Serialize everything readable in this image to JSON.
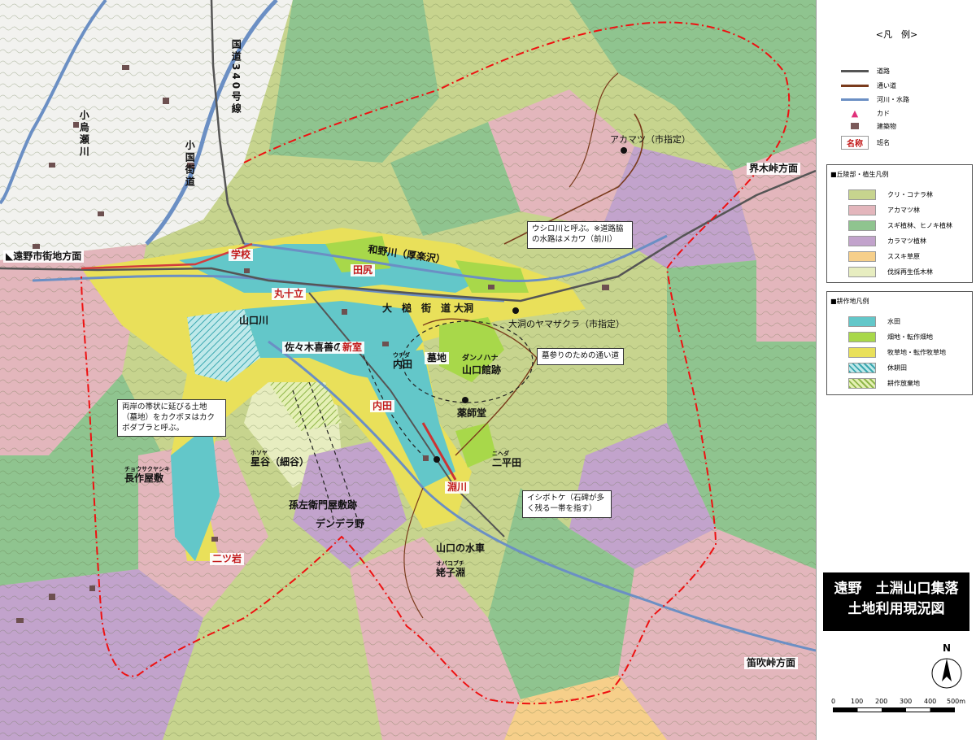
{
  "legend": {
    "title": "<凡　例>",
    "items": [
      {
        "label": "道路",
        "color": "#555555",
        "kind": "line"
      },
      {
        "label": "通い道",
        "color": "#7a3b1c",
        "kind": "line"
      },
      {
        "label": "河川・水路",
        "color": "#6b8fc4",
        "kind": "line"
      },
      {
        "label": "カド",
        "color": "#e0307a",
        "kind": "triangle"
      },
      {
        "label": "建築物",
        "color": "#7b5a5a",
        "kind": "square"
      },
      {
        "label": "班名",
        "color": "#c21a1a",
        "kind": "name",
        "sample": "名称"
      }
    ],
    "forest": {
      "heading": "■丘陵部・植生凡例",
      "items": [
        {
          "label": "クリ・コナラ林",
          "color": "#c7d48e"
        },
        {
          "label": "アカマツ林",
          "color": "#e3b6bc"
        },
        {
          "label": "スギ植林、ヒノキ植林",
          "color": "#8fc48f"
        },
        {
          "label": "カラマツ植林",
          "color": "#c2a3cc"
        },
        {
          "label": "ススキ草原",
          "color": "#f6cf8a"
        },
        {
          "label": "伐採再生低木林",
          "color": "#e7edc0"
        }
      ]
    },
    "farm": {
      "heading": "■耕作地凡例",
      "items": [
        {
          "label": "水田",
          "color": "#63c7c9",
          "pattern": "solid"
        },
        {
          "label": "畑地・転作畑地",
          "color": "#a8d84a",
          "pattern": "solid"
        },
        {
          "label": "牧草地・転作牧草地",
          "color": "#e9e05a",
          "pattern": "solid"
        },
        {
          "label": "休耕田",
          "color": "#63c7c9",
          "pattern": "hatch"
        },
        {
          "label": "耕作放棄地",
          "color": "#a8d84a",
          "pattern": "hatch"
        }
      ]
    }
  },
  "title_box": {
    "line1": "遠野　土淵山口集落",
    "line2": "土地利用現況図"
  },
  "north": "N",
  "scale": {
    "ticks": [
      "0",
      "100",
      "200",
      "300",
      "400",
      "500m"
    ]
  },
  "map_labels": {
    "dir_tono": "◣遠野市街地方面",
    "dir_sakaiki": "界木峠方面",
    "dir_fuefuki": "笛吹峠方面",
    "akamatsu": "アカマツ（市指定）",
    "yamazakura": "大洞のヤマザクラ（市指定）",
    "route340_a": "国道",
    "route340_b": "340",
    "route340_c": "号線",
    "kojima": "小烏瀬川",
    "kokuni": "小国街道",
    "wanokawa": "和野川（厚楽沢）",
    "otsuchi": "大槌街道",
    "obora": "大洞",
    "yamaguchi_river": "山口川",
    "gakko": "学校",
    "taji": "田尻",
    "marujuritsu": "丸十立",
    "sasaki": "佐々木喜善の家",
    "shinmuro": "新室",
    "uchida_kana": "ウチダ",
    "uchida": "内田",
    "uchida2": "内田",
    "bochi": "墓地",
    "danno_kana": "ダンノハナ",
    "dannohana": "山口館跡",
    "yakushido": "薬師堂",
    "futahenda_kana": "ニヘダ",
    "futahenda": "二平田",
    "fuchikawa": "淵川",
    "hosoya_kana": "ホソヤ",
    "hosoya": "星谷（細谷）",
    "chosaku_kana": "チョウサクヤシキ",
    "chosaku": "長作屋敷",
    "magozaemon": "孫左衛門屋敷跡",
    "denderano": "デンデラ野",
    "futatsuiwa": "二ツ岩",
    "suisha": "山口の水車",
    "obako_kana": "オバコブチ",
    "obako": "姥子淵",
    "note_ushiro": "ウシロ川と呼ぶ。※道路脇の水路はメカワ（前川）",
    "note_kayoi": "墓参りのための通い道",
    "note_kakobota": "両岸の帯状に延びる土地（墓地）をカクボヌはカクボダブラと呼ぶ。",
    "note_ishibotoke": "イシボトケ（石碑が多く残る一帯を指す）"
  }
}
